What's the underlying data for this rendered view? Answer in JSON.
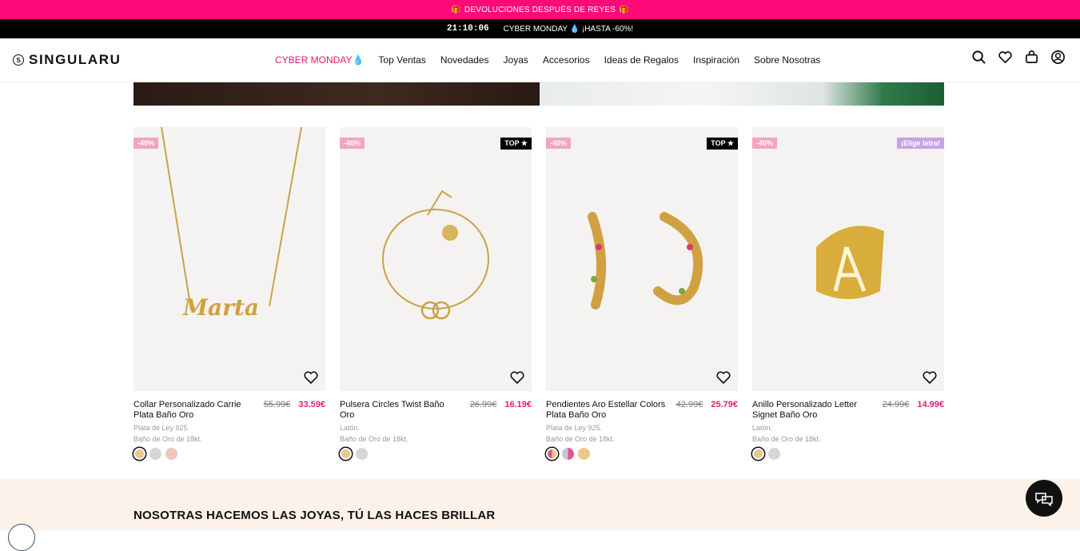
{
  "promo": {
    "text": "DEVOLUCIONES DESPUÉS DE REYES",
    "icon": "gift-icon"
  },
  "countdown": {
    "timer": "21:10:06",
    "text": "CYBER MONDAY 💧 ¡HASTA -60%!"
  },
  "brand": {
    "name": "SINGULARU",
    "mark": "S",
    "accent": "#e8196f",
    "promo_bg": "#ff0a78"
  },
  "nav": {
    "cyber": "CYBER MONDAY",
    "items": [
      "Top Ventas",
      "Novedades",
      "Joyas",
      "Accesorios",
      "Ideas de Regalos",
      "Inspiración",
      "Sobre Nosotras"
    ]
  },
  "header_icons": [
    "search-icon",
    "heart-icon",
    "bag-icon",
    "user-icon"
  ],
  "products": [
    {
      "name": "Collar Personalizado Carrie Plata Baño Oro",
      "old_price": "55.99€",
      "price": "33.59€",
      "discount": "-40%",
      "tag": "",
      "material": "Plata de Ley 925.",
      "plating": "Baño de Oro de 18kt.",
      "swatches": [
        "#e8c98a",
        "#d6d6d6",
        "#f0c7bb"
      ]
    },
    {
      "name": "Pulsera Circles Twist Baño Oro",
      "old_price": "26.99€",
      "price": "16.19€",
      "discount": "-40%",
      "tag": "TOP ★",
      "material": "Latón.",
      "plating": "Baño de Oro de 18kt.",
      "swatches": [
        "#e8c98a",
        "#d6d6d6"
      ]
    },
    {
      "name": "Pendientes Aro Estellar Colors Plata Baño Oro",
      "old_price": "42.99€",
      "price": "25.79€",
      "discount": "-40%",
      "tag": "TOP ★",
      "material": "Plata de Ley 925.",
      "plating": "Baño de Oro de 18kt.",
      "swatches": [
        "#e0568a",
        "#c9c6dc",
        "#e8c98a"
      ]
    },
    {
      "name": "Anillo Personalizado Letter Signet Baño Oro",
      "old_price": "24.99€",
      "price": "14.99€",
      "discount": "-40%",
      "tag": "¡Elige letra!",
      "material": "Latón.",
      "plating": "Baño de Oro de 18kt.",
      "swatches": [
        "#e8c98a",
        "#d6d6d6"
      ]
    }
  ],
  "section": {
    "title": "NOSOTRAS HACEMOS LAS JOYAS, TÚ LAS HACES BRILLAR"
  }
}
